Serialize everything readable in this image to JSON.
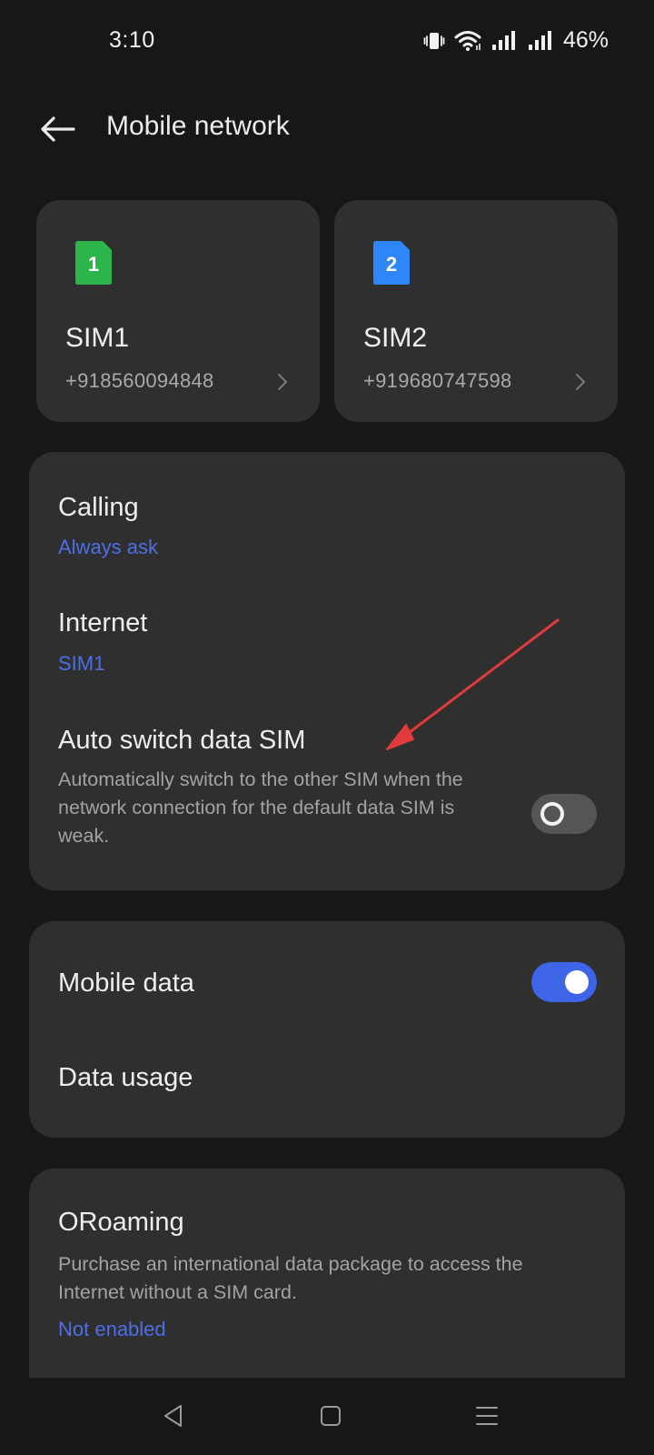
{
  "status_bar": {
    "time": "3:10",
    "battery": "46%",
    "icons": [
      "vibrate-icon",
      "wifi-icon",
      "signal-icon",
      "signal-icon"
    ]
  },
  "header": {
    "title": "Mobile network",
    "back_icon": "back-arrow-icon"
  },
  "sim_cards": [
    {
      "badge": "1",
      "name": "SIM1",
      "number": "+918560094848",
      "color": "#2bb54a"
    },
    {
      "badge": "2",
      "name": "SIM2",
      "number": "+919680747598",
      "color": "#2f86f6"
    }
  ],
  "settings": {
    "calling": {
      "title": "Calling",
      "value": "Always ask"
    },
    "internet": {
      "title": "Internet",
      "value": "SIM1"
    },
    "auto_switch": {
      "title": "Auto switch data SIM",
      "description": "Automatically switch to the other SIM when the network connection for the default data SIM is weak.",
      "enabled": false
    },
    "mobile_data": {
      "title": "Mobile data",
      "enabled": true
    },
    "data_usage": {
      "title": "Data usage"
    },
    "oroaming": {
      "title": "ORoaming",
      "description": "Purchase an international data package to access the Internet without a SIM card.",
      "value": "Not enabled"
    }
  },
  "colors": {
    "accent": "#3e64e8",
    "link": "#4d6fe6",
    "annotation": "#e03a3a",
    "card": "#2f2f2f",
    "background": "#171717"
  },
  "nav_bar": {
    "icons": [
      "back-triangle-icon",
      "home-square-icon",
      "recents-menu-icon"
    ]
  }
}
